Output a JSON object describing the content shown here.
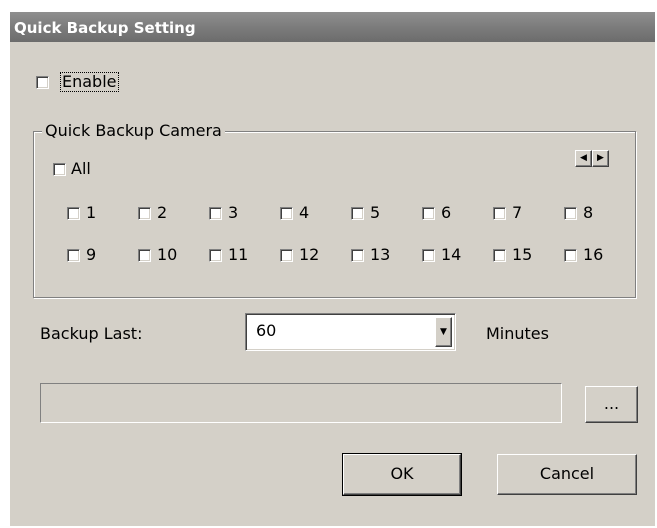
{
  "window": {
    "title": "Quick Backup Setting"
  },
  "enable": {
    "label": "Enable",
    "checked": false
  },
  "camera_group": {
    "legend": "Quick Backup Camera",
    "all_label": "All",
    "scroll_left_icon": "triangle-left-icon",
    "scroll_right_icon": "triangle-right-icon",
    "cameras": [
      "1",
      "2",
      "3",
      "4",
      "5",
      "6",
      "7",
      "8",
      "9",
      "10",
      "11",
      "12",
      "13",
      "14",
      "15",
      "16"
    ]
  },
  "backup_last": {
    "label": "Backup Last:",
    "value": "60",
    "unit": "Minutes",
    "dropdown_icon": "triangle-down-icon"
  },
  "path": {
    "value": "",
    "browse_label": "..."
  },
  "buttons": {
    "ok": "OK",
    "cancel": "Cancel"
  },
  "colors": {
    "face": "#d4d0c8",
    "title_bar": "#7a7a7a",
    "title_text": "#ffffff"
  }
}
